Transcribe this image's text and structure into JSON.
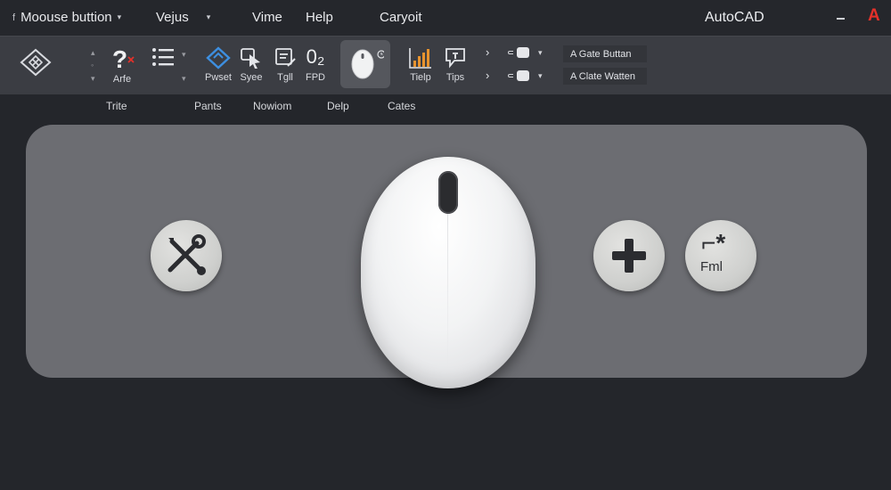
{
  "menu": {
    "items": [
      {
        "label": "Moouse buttion",
        "has_caret": true
      },
      {
        "label": "Vejus",
        "has_caret": true
      },
      {
        "label": "Vime",
        "has_caret": false
      },
      {
        "label": "Help",
        "has_caret": false
      },
      {
        "label": "Caryoit",
        "has_caret": false
      }
    ],
    "app_name": "AutoCAD",
    "brand_letter": "A",
    "brand_color": "#e3312a"
  },
  "ribbon": {
    "tools": [
      {
        "label": "",
        "icon": "cad-logo-icon"
      },
      {
        "label": "Arfe",
        "icon": "help-question-icon"
      },
      {
        "label": "",
        "icon": "list-icon"
      },
      {
        "label": "Pwset",
        "icon": "select-diamond-icon"
      },
      {
        "label": "Syee",
        "icon": "pointer-arrow-icon"
      },
      {
        "label": "Tgll",
        "icon": "text-edit-icon"
      },
      {
        "label": "FPD",
        "icon": "coordinate-icon",
        "glyph": "0₂"
      },
      {
        "label": "",
        "icon": "mouse-icon"
      },
      {
        "label": "Tielp",
        "icon": "bar-chart-icon"
      },
      {
        "label": "Tips",
        "icon": "tips-bubble-icon"
      }
    ],
    "gate_buttons": [
      "A Gate Buttan",
      "A Clate Watten"
    ],
    "group_labels": [
      "Trite",
      "Pants",
      "Nowiom",
      "Delp",
      "Cates"
    ]
  },
  "panel": {
    "fnl_text": "Fml",
    "fnl_glyph": "⌐*"
  },
  "colors": {
    "background": "#24262b",
    "ribbon": "#3b3d43",
    "panel": "#6c6d72",
    "accent_blue": "#3d8fe0",
    "accent_orange": "#e7932f"
  }
}
